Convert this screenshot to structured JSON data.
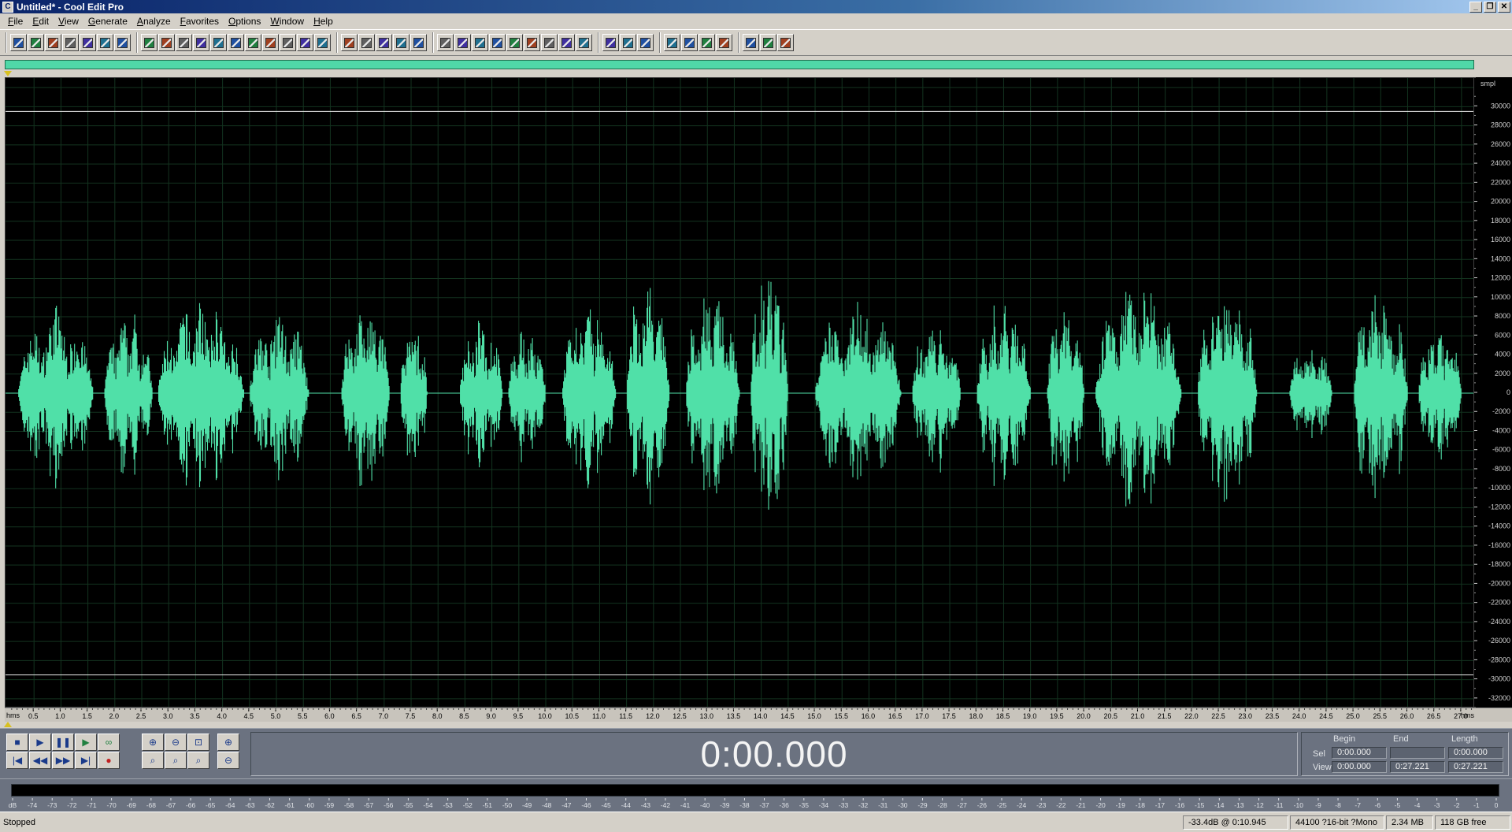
{
  "window": {
    "title": "Untitled* - Cool Edit Pro",
    "controls": [
      "_",
      "❐",
      "✕"
    ]
  },
  "menu": [
    "File",
    "Edit",
    "View",
    "Generate",
    "Analyze",
    "Favorites",
    "Options",
    "Window",
    "Help"
  ],
  "toolbar_groups": [
    [
      "waveform-view-icon",
      "multitrack-view-icon",
      "open-icon",
      "save-icon",
      "save-as-icon",
      "close-file-icon",
      "new-icon"
    ],
    [
      "undo-icon",
      "redo-icon",
      "repeat-icon",
      "copy-icon",
      "copy-new-icon",
      "cut-icon",
      "paste-icon",
      "paste-new-icon",
      "mix-paste-icon",
      "trim-icon",
      "delete-silence-icon"
    ],
    [
      "envelope-icon",
      "amplify-icon",
      "normalize-icon",
      "fade-icon",
      "noise-reduction-icon"
    ],
    [
      "spectral-view-icon",
      "cue-list-icon",
      "play-list-icon",
      "play-icon",
      "snap-icon",
      "time-format-icon",
      "batch-icon",
      "device-icon",
      "settings-icon"
    ],
    [
      "cd-icon",
      "scripts-icon",
      "help-icon"
    ],
    [
      "effect-1-icon",
      "effect-2-icon",
      "effect-3-icon",
      "effect-4-icon"
    ],
    [
      "tool-1-icon",
      "tool-2-icon",
      "tool-3-icon"
    ]
  ],
  "amplitude_axis": {
    "unit": "smpl",
    "labels": [
      "30000",
      "28000",
      "26000",
      "24000",
      "22000",
      "20000",
      "18000",
      "16000",
      "14000",
      "12000",
      "10000",
      "8000",
      "6000",
      "4000",
      "2000",
      "0",
      "-2000",
      "-4000",
      "-6000",
      "-8000",
      "-10000",
      "-12000",
      "-14000",
      "-16000",
      "-18000",
      "-20000",
      "-22000",
      "-24000",
      "-26000",
      "-28000",
      "-30000",
      "-32000"
    ]
  },
  "time_axis": {
    "unit": "hms",
    "labels": [
      "0.5",
      "1.0",
      "1.5",
      "2.0",
      "2.5",
      "3.0",
      "3.5",
      "4.0",
      "4.5",
      "5.0",
      "5.5",
      "6.0",
      "6.5",
      "7.0",
      "7.5",
      "8.0",
      "8.5",
      "9.0",
      "9.5",
      "10.0",
      "10.5",
      "11.0",
      "11.5",
      "12.0",
      "12.5",
      "13.0",
      "13.5",
      "14.0",
      "14.5",
      "15.0",
      "15.5",
      "16.0",
      "16.5",
      "17.0",
      "17.5",
      "18.0",
      "18.5",
      "19.0",
      "19.5",
      "20.0",
      "20.5",
      "21.0",
      "21.5",
      "22.0",
      "22.5",
      "23.0",
      "23.5",
      "24.0",
      "24.5",
      "25.0",
      "25.5",
      "26.0",
      "26.5",
      "27.0"
    ]
  },
  "waveform": {
    "color": "#50e0a8",
    "duration_s": 27.221,
    "clip_level": 29500,
    "bursts": [
      {
        "start": 0.2,
        "end": 1.6,
        "peak": 9000
      },
      {
        "start": 1.8,
        "end": 2.7,
        "peak": 8500
      },
      {
        "start": 2.8,
        "end": 4.4,
        "peak": 10000
      },
      {
        "start": 4.5,
        "end": 5.6,
        "peak": 8800
      },
      {
        "start": 6.2,
        "end": 7.1,
        "peak": 10000
      },
      {
        "start": 7.3,
        "end": 7.8,
        "peak": 7500
      },
      {
        "start": 8.4,
        "end": 9.2,
        "peak": 8000
      },
      {
        "start": 9.3,
        "end": 10.0,
        "peak": 6800
      },
      {
        "start": 10.3,
        "end": 11.3,
        "peak": 9500
      },
      {
        "start": 11.5,
        "end": 12.3,
        "peak": 12000
      },
      {
        "start": 12.6,
        "end": 13.6,
        "peak": 11500
      },
      {
        "start": 13.8,
        "end": 14.5,
        "peak": 13500
      },
      {
        "start": 15.0,
        "end": 16.6,
        "peak": 10000
      },
      {
        "start": 16.8,
        "end": 17.7,
        "peak": 8000
      },
      {
        "start": 18.0,
        "end": 19.0,
        "peak": 10000
      },
      {
        "start": 19.3,
        "end": 20.0,
        "peak": 10000
      },
      {
        "start": 20.2,
        "end": 21.8,
        "peak": 12000
      },
      {
        "start": 22.1,
        "end": 23.2,
        "peak": 12000
      },
      {
        "start": 23.8,
        "end": 24.6,
        "peak": 5500
      },
      {
        "start": 25.0,
        "end": 26.0,
        "peak": 12000
      },
      {
        "start": 26.2,
        "end": 27.0,
        "peak": 7500
      }
    ]
  },
  "transport": {
    "row1": [
      {
        "name": "stop-button",
        "icon": "■"
      },
      {
        "name": "play-button",
        "icon": "▶"
      },
      {
        "name": "pause-button",
        "icon": "❚❚"
      },
      {
        "name": "play-to-end-button",
        "icon": "▶"
      },
      {
        "name": "loop-button",
        "icon": "∞"
      }
    ],
    "row2": [
      {
        "name": "go-to-start-button",
        "icon": "|◀"
      },
      {
        "name": "rewind-button",
        "icon": "◀◀"
      },
      {
        "name": "fast-forward-button",
        "icon": "▶▶"
      },
      {
        "name": "go-to-end-button",
        "icon": "▶|"
      },
      {
        "name": "record-button",
        "icon": "●"
      }
    ]
  },
  "time_display": "0:00.000",
  "selection": {
    "headers": {
      "begin": "Begin",
      "end": "End",
      "length": "Length"
    },
    "sel": {
      "label": "Sel",
      "begin": "0:00.000",
      "end": "",
      "length": "0:00.000"
    },
    "view": {
      "label": "View",
      "begin": "0:00.000",
      "end": "0:27.221",
      "length": "0:27.221"
    }
  },
  "level_meter": {
    "labels": [
      "dB",
      "-74",
      "-73",
      "-72",
      "-71",
      "-70",
      "-69",
      "-68",
      "-67",
      "-66",
      "-65",
      "-64",
      "-63",
      "-62",
      "-61",
      "-60",
      "-59",
      "-58",
      "-57",
      "-56",
      "-55",
      "-54",
      "-53",
      "-52",
      "-51",
      "-50",
      "-49",
      "-48",
      "-47",
      "-46",
      "-45",
      "-44",
      "-43",
      "-42",
      "-41",
      "-40",
      "-39",
      "-38",
      "-37",
      "-36",
      "-35",
      "-34",
      "-33",
      "-32",
      "-31",
      "-30",
      "-29",
      "-28",
      "-27",
      "-26",
      "-25",
      "-24",
      "-23",
      "-22",
      "-21",
      "-20",
      "-19",
      "-18",
      "-17",
      "-16",
      "-15",
      "-14",
      "-13",
      "-12",
      "-11",
      "-10",
      "-9",
      "-8",
      "-7",
      "-6",
      "-5",
      "-4",
      "-3",
      "-2",
      "-1",
      "0"
    ]
  },
  "status": {
    "text": "Stopped",
    "cursor": "-33.4dB @   0:10.945",
    "format": "44100 ?16-bit ?Mono",
    "size": "2.34 MB",
    "free": "118 GB free"
  }
}
